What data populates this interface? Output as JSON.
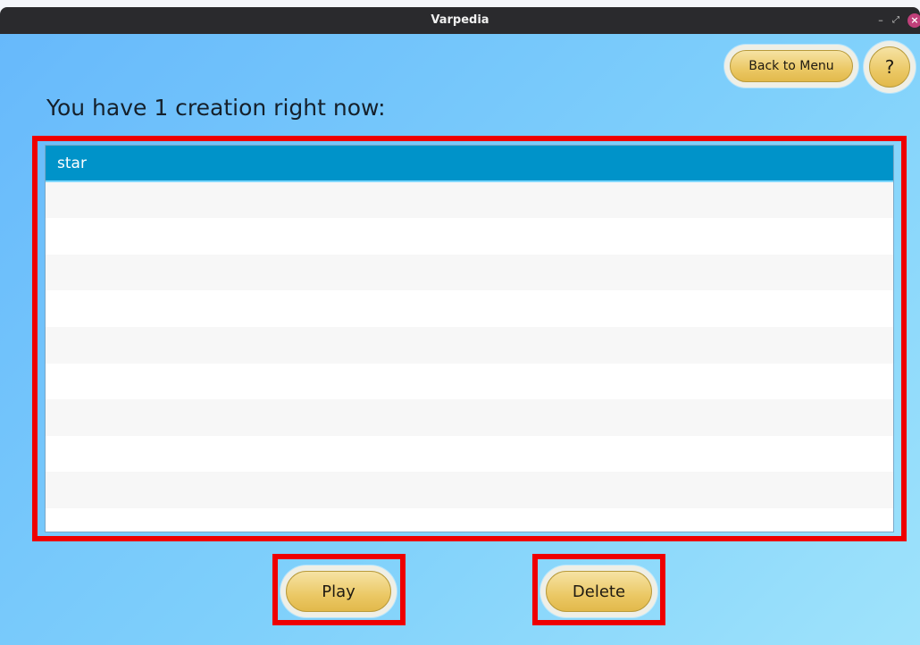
{
  "window": {
    "title": "Varpedia"
  },
  "titlebar": {
    "minimize": "–",
    "maximize": "⤢",
    "close": "×"
  },
  "header": {
    "back_label": "Back to Menu",
    "help_label": "?"
  },
  "heading": "You have 1 creation right now:",
  "creations": [
    {
      "label": "star",
      "selected": true
    }
  ],
  "actions": {
    "play_label": "Play",
    "delete_label": "Delete"
  },
  "colors": {
    "highlight": "#ee0000",
    "selected_row": "#0093c9",
    "button_gold": "#ebc865"
  }
}
